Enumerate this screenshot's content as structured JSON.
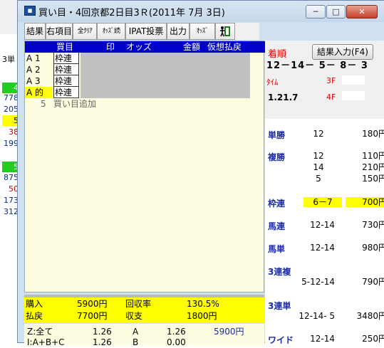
{
  "window": {
    "title": "買い目・4回京都2日目3Ｒ(2011年 7月 3日)",
    "icon": "app-icon",
    "controls": [
      "─",
      "□",
      "✕"
    ]
  },
  "background_window": {
    "header": "3単",
    "badge_top": "4",
    "values_top": [
      "778",
      "205",
      "5",
      "38",
      "199"
    ],
    "badge_bottom": "5",
    "values_bottom": [
      "875",
      "50",
      "173",
      "312"
    ]
  },
  "toolbar": {
    "buttons": [
      "結果",
      "右項目",
      "全ｸﾘｱ",
      "ｵｯｽﾞ読",
      "IPAT投票",
      "出力",
      "ｵｯｽﾞ"
    ],
    "exit_icon": "exit-door-icon"
  },
  "bets": {
    "headers": {
      "bet": "買目",
      "mark": "印",
      "odds": "オッズ",
      "amount": "金額",
      "payout": "仮想払戻"
    },
    "rows": [
      {
        "mark": "A  1",
        "type": "枠連"
      },
      {
        "mark": "A  2",
        "type": "枠連"
      },
      {
        "mark": "A  3",
        "type": "枠連"
      },
      {
        "mark": "A 的",
        "type": "枠連"
      }
    ],
    "add_row": {
      "num": "5",
      "label": "買い目追加"
    }
  },
  "summary": {
    "purchase_label": "購入",
    "purchase_value": "5900円",
    "return_rate_label": "回収率",
    "return_rate_value": "130.5%",
    "payout_label": "払戻",
    "payout_value": "7700円",
    "balance_label": "収支",
    "balance_value": "1800円"
  },
  "detail": {
    "row1": {
      "label": "Z:全て",
      "odds": "1.26",
      "mark": "A",
      "odds2": "1.26",
      "amount": "5900円"
    },
    "row2": {
      "label": "I:A+B+C",
      "odds": "1.26",
      "mark": "B",
      "odds2": "0.00"
    }
  },
  "result": {
    "label": "着順",
    "input_button": "結果入力(F4)",
    "order": "12－14－ 5－ 8－ 3",
    "time_label": "ﾀｲﾑ",
    "f3_label": "3F",
    "time_value": "1.21.7",
    "f4_label": "4F",
    "payouts": {
      "win": {
        "label": "単勝",
        "items": [
          {
            "comb": "12",
            "amount": "180円"
          }
        ]
      },
      "place": {
        "label": "複勝",
        "items": [
          {
            "comb": "12",
            "amount": "110円"
          },
          {
            "comb": "14",
            "amount": "210円"
          },
          {
            "comb": "5",
            "amount": "150円"
          }
        ]
      },
      "bracket": {
        "label": "枠連",
        "items": [
          {
            "comb": "6－7",
            "amount": "700円"
          }
        ]
      },
      "quinella": {
        "label": "馬連",
        "items": [
          {
            "comb": "12-14",
            "amount": "730円"
          }
        ]
      },
      "exacta": {
        "label": "馬単",
        "items": [
          {
            "comb": "12-14",
            "amount": "980円"
          }
        ]
      },
      "trio": {
        "label": "3連複",
        "items": [
          {
            "comb": "5-12-14",
            "amount": "790円"
          }
        ]
      },
      "trifecta": {
        "label": "3連単",
        "items": [
          {
            "comb": "12-14- 5",
            "amount": "3480円"
          }
        ]
      },
      "wide": {
        "label": "ワイド",
        "items": [
          {
            "comb": "12-14",
            "amount": "250円"
          }
        ]
      }
    }
  },
  "colors": {
    "header_blue": "#0000c8",
    "highlight_yellow": "#ffff00",
    "label_red": "#e00000",
    "label_navy": "#1a2aa8"
  }
}
